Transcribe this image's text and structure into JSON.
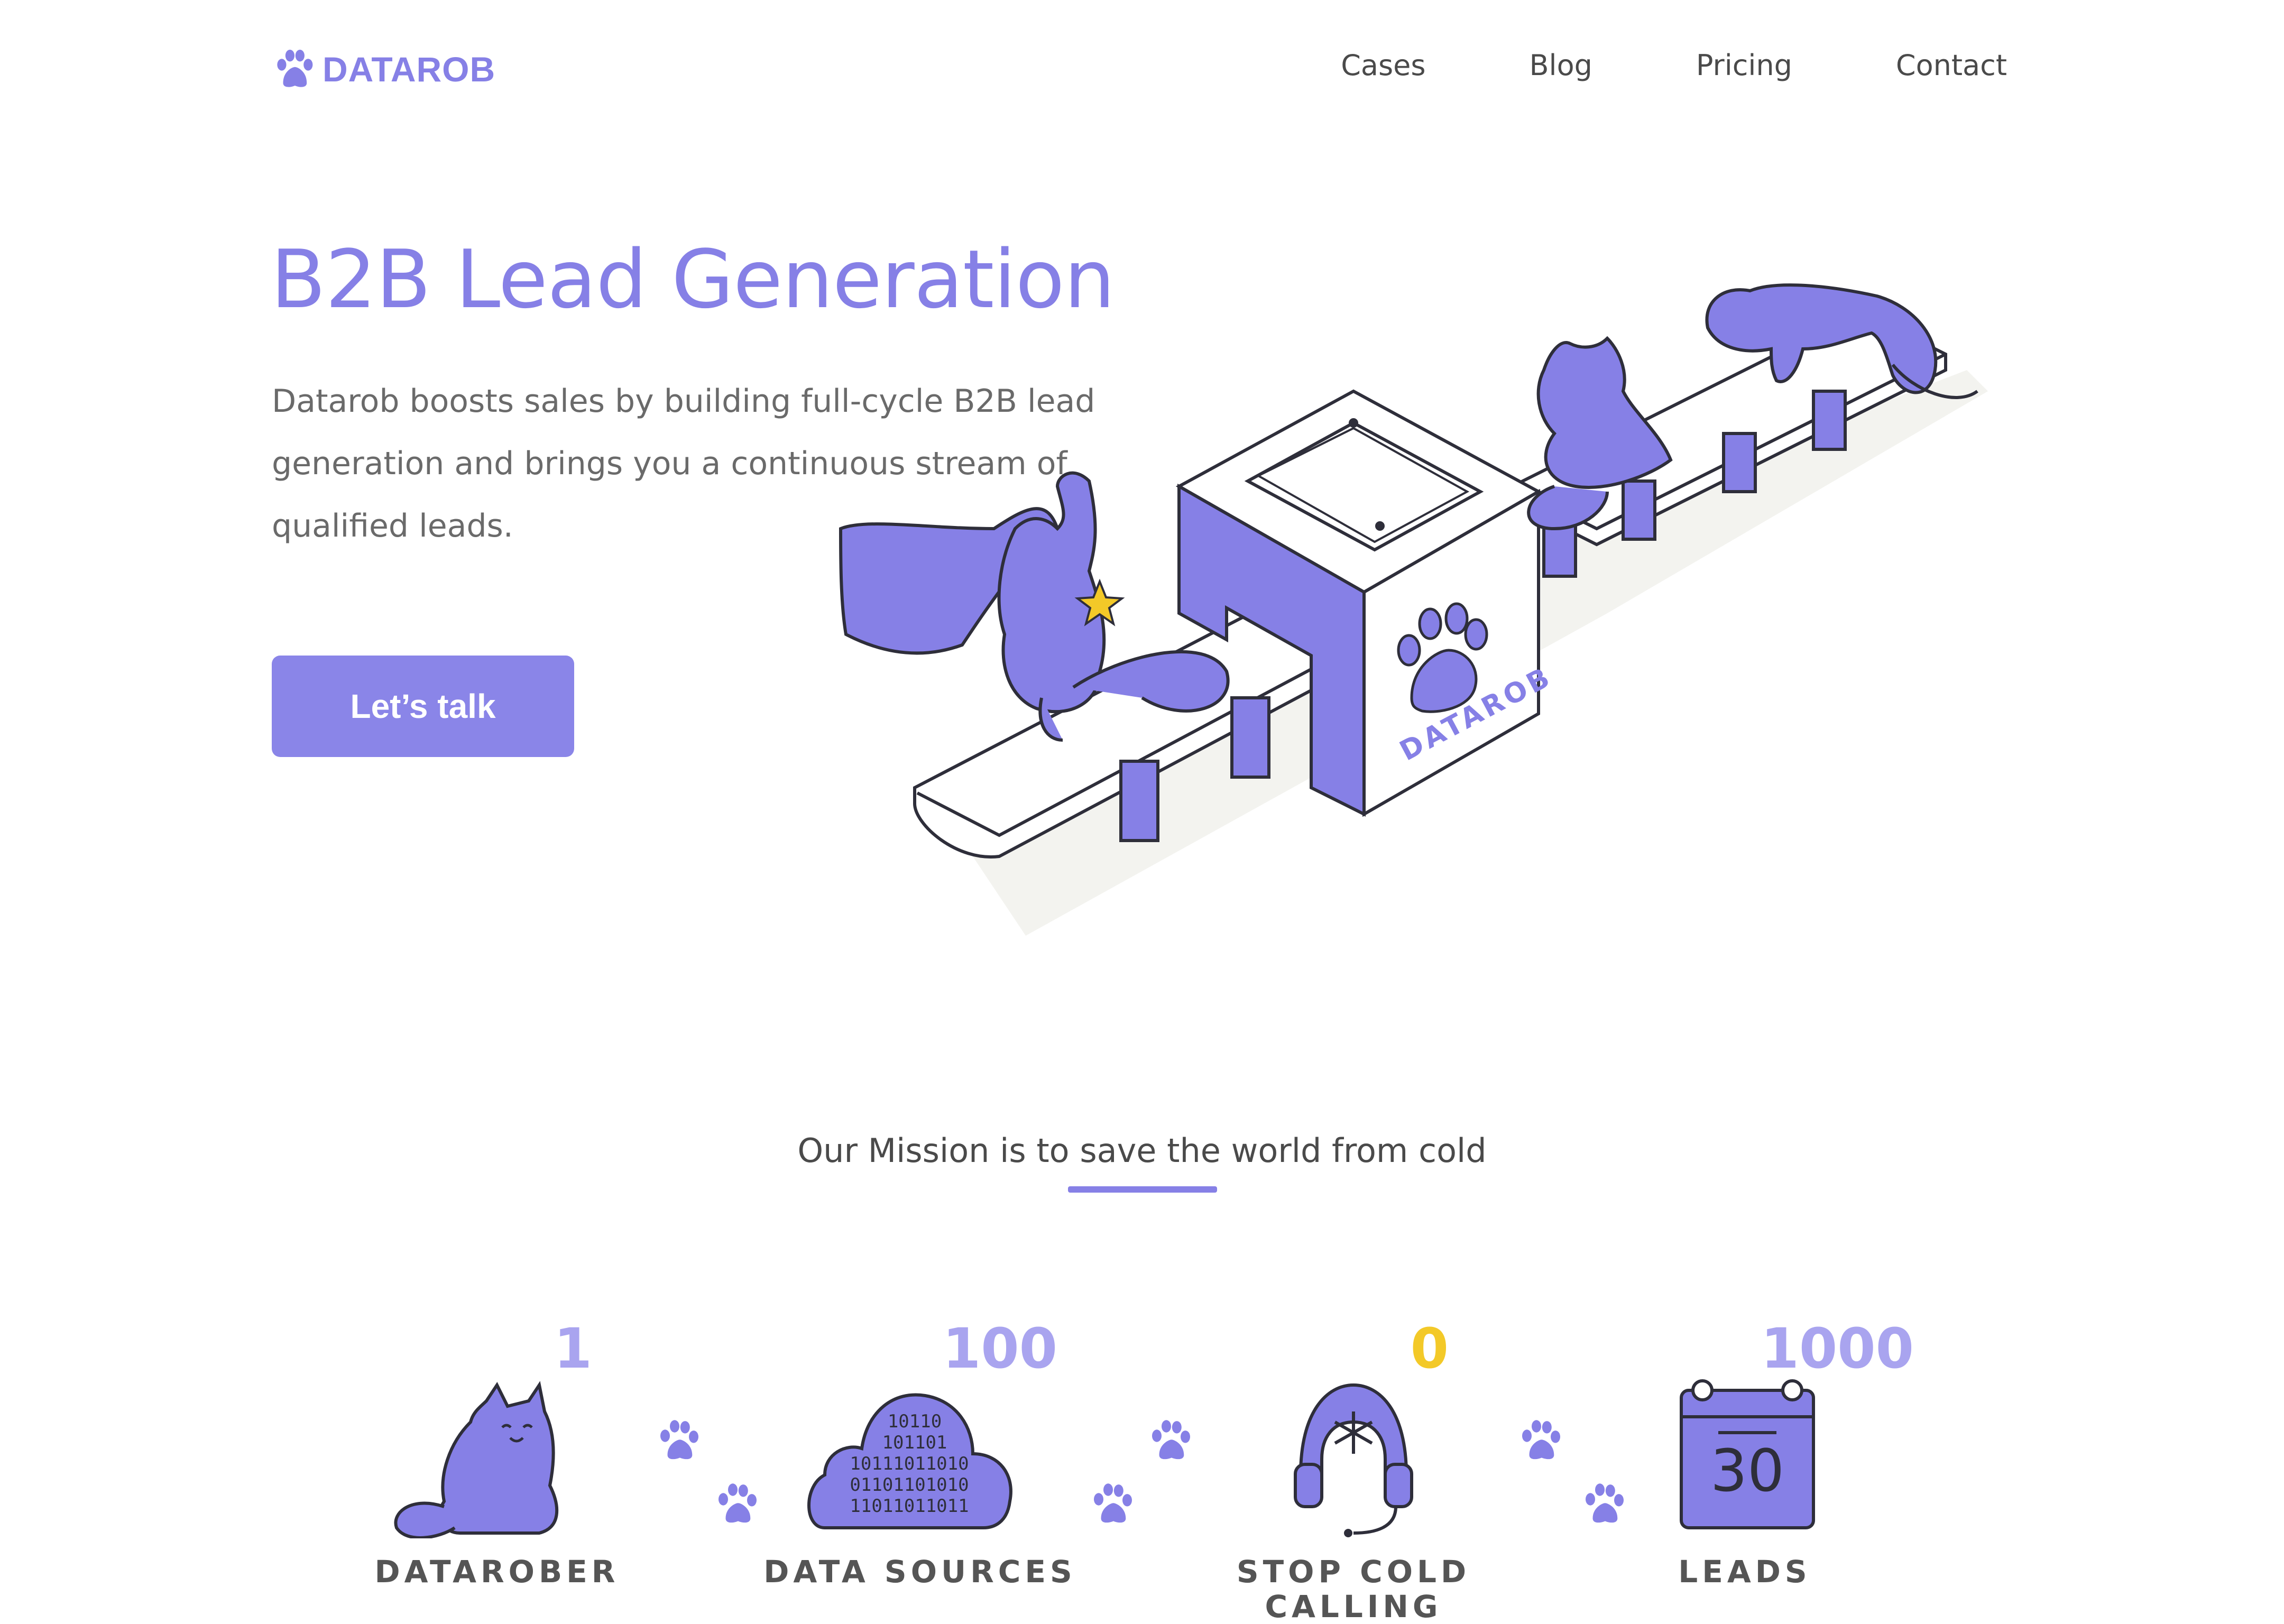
{
  "header": {
    "logo_text": "DATAROB",
    "nav": [
      "Cases",
      "Blog",
      "Pricing",
      "Contact"
    ]
  },
  "hero": {
    "title": "B2B Lead Generation",
    "description": "Datarob boosts sales by building full-cycle B2B lead generation and brings you a continuous stream of qualified leads.",
    "cta_label": "Let’s talk",
    "box_label": "DATAROB"
  },
  "mission": {
    "text": "Our Mission is to save the world from cold"
  },
  "stats": [
    {
      "value": "1",
      "label": "DATAROBER",
      "icon": "cat-icon"
    },
    {
      "value": "100",
      "label": "DATA SOURCES",
      "icon": "binary-cloud-icon"
    },
    {
      "value": "0",
      "label": "STOP COLD CALLING",
      "icon": "headset-snowflake-icon"
    },
    {
      "value": "1000",
      "label": "LEADS",
      "icon": "calendar-icon",
      "calendar_number": "30"
    }
  ],
  "colors": {
    "accent": "#8680e6",
    "button": "#8a85e8",
    "stat_number": "#a9a4ef",
    "stat_zero": "#f3c928",
    "text": "#4a4a4a"
  }
}
